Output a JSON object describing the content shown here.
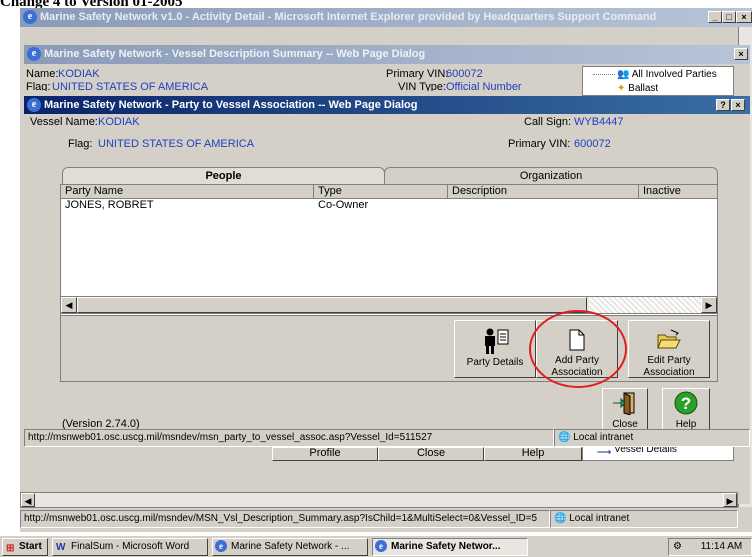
{
  "document_heading": "Change 4 to Version 01-2005",
  "ie_window": {
    "title": "Marine Safety Network v1.0 - Activity Detail - Microsoft Internet Explorer provided by Headquarters Support Command"
  },
  "vessel_summary_dialog": {
    "title": "Marine Safety Network - Vessel Description Summary -- Web Page Dialog",
    "name_label": "Name:",
    "name_value": "KODIAK",
    "flag_label": "Flag:",
    "flag_value": "UNITED STATES OF AMERICA",
    "primary_vin_label": "Primary VIN:",
    "primary_vin_value": "600072",
    "vin_type_label": "VIN Type:",
    "vin_type_value": "Official Number",
    "tree_item_1": "All Involved Parties",
    "tree_item_2": "Ballast",
    "tree_item_vessel_details": "Vessel Details",
    "bottom_buttons": [
      "Profile",
      "Close",
      "Help"
    ],
    "status_url": "http://msnweb01.osc.uscg.mil/msndev/MSN_Vsl_Description_Summary.asp?IsChild=1&MultiSelect=0&Vessel_ID=5",
    "status_zone": "Local intranet"
  },
  "party_dialog": {
    "title": "Marine Safety Network - Party to Vessel Association -- Web Page Dialog",
    "vessel_name_label": "Vessel Name:",
    "vessel_name_value": "KODIAK",
    "call_sign_label": "Call Sign:",
    "call_sign_value": "WYB4447",
    "flag_label": "Flag:",
    "flag_value": "UNITED STATES OF AMERICA",
    "primary_vin_label": "Primary VIN:",
    "primary_vin_value": "600072",
    "tabs": [
      "People",
      "Organization"
    ],
    "columns": [
      "Party Name",
      "Type",
      "Description",
      "Inactive"
    ],
    "rows": [
      {
        "party_name": "JONES, ROBRET",
        "type": "Co-Owner",
        "description": "",
        "inactive": ""
      }
    ],
    "buttons": {
      "party_details": "Party Details",
      "add_party_association": "Add Party Association",
      "edit_party_association": "Edit Party Association",
      "close": "Close",
      "help": "Help"
    },
    "version": "(Version 2.74.0)",
    "status_url": "http://msnweb01.osc.uscg.mil/msndev/msn_party_to_vessel_assoc.asp?Vessel_Id=511527",
    "status_zone": "Local intranet"
  },
  "taskbar": {
    "start": "Start",
    "items": [
      "FinalSum - Microsoft Word",
      "Marine Safety Network - ...",
      "Marine Safety Networ..."
    ],
    "time": "11:14 AM"
  },
  "colors": {
    "annotation_circle": "#e02020",
    "title_active": "#0a246a",
    "title_inactive": "#8a9bb8",
    "value_text": "#1f3fbf"
  }
}
